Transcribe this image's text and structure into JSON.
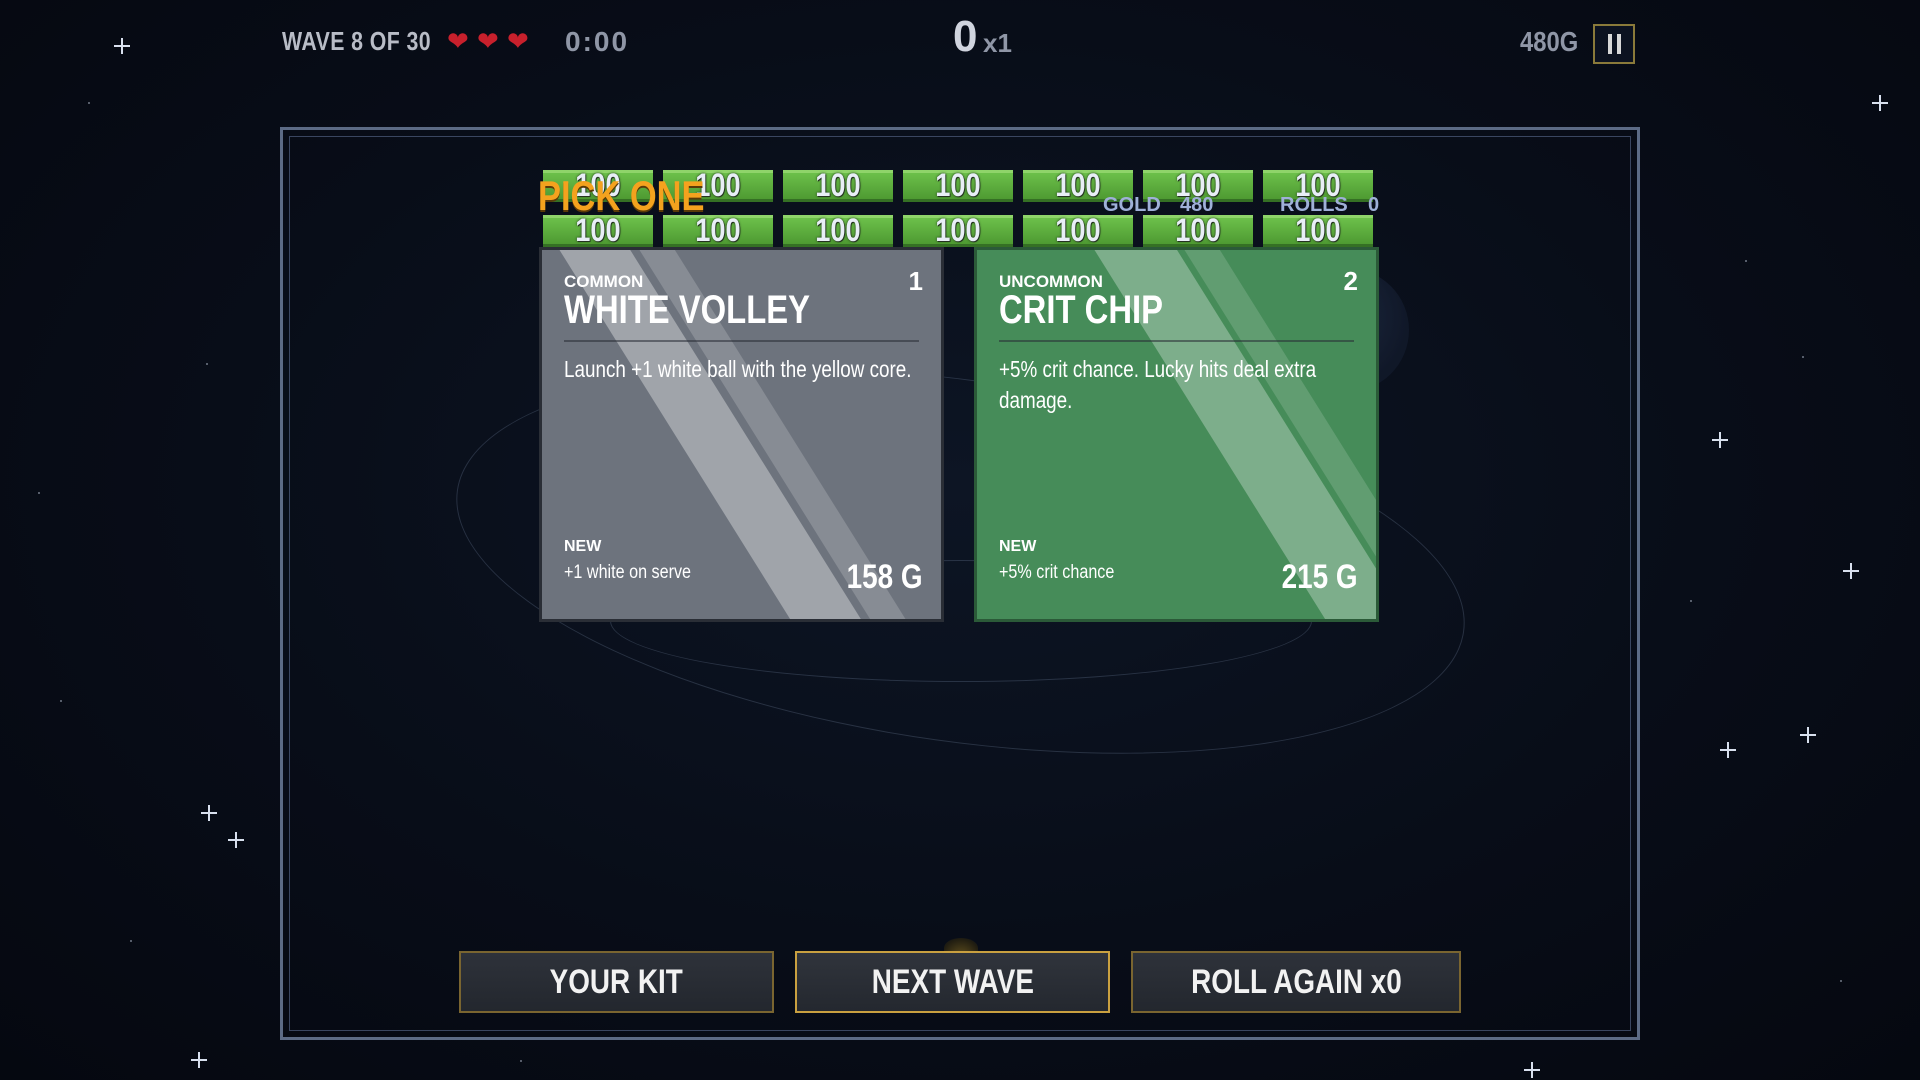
{
  "hud": {
    "wave": "WAVE  8 OF 30",
    "lives": 3,
    "timer": "0:00",
    "score": "0",
    "multiplier": "x1",
    "gold": "480G"
  },
  "bricks": {
    "row1": [
      "100",
      "100",
      "100",
      "100",
      "100",
      "100",
      "100"
    ],
    "row2": [
      "100",
      "100",
      "100",
      "100",
      "100",
      "100",
      "100"
    ]
  },
  "shop": {
    "heading": "PICK ONE",
    "gold_label": "GOLD",
    "gold_value": "480",
    "rolls_label": "ROLLS",
    "rolls_value": "0"
  },
  "cards": [
    {
      "rarity": "COMMON",
      "number": "1",
      "title": "WHITE VOLLEY",
      "description": "Launch +1 white ball with the yellow core.",
      "status": "NEW",
      "bonus": "+1 white on serve",
      "price": "158 G",
      "color": "#6d737d"
    },
    {
      "rarity": "UNCOMMON",
      "number": "2",
      "title": "CRIT CHIP",
      "description": "+5% crit chance. Lucky hits deal extra damage.",
      "status": "NEW",
      "bonus": "+5% crit chance",
      "price": "215 G",
      "color": "#468c59"
    }
  ],
  "buttons": {
    "kit": "YOUR KIT",
    "next": "NEXT WAVE",
    "roll": "ROLL AGAIN  x0"
  },
  "colors": {
    "accent": "#f4a21e",
    "heart": "#c8202c",
    "brick": "#5fae3e",
    "frame": "#5c6b85"
  },
  "icons": [
    "heart-icon",
    "pause-icon"
  ]
}
